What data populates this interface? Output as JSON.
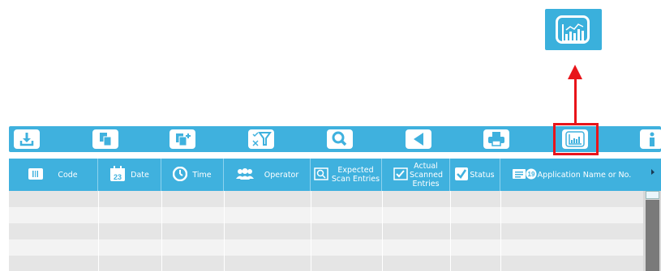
{
  "toolbar": {
    "buttons": [
      {
        "name": "download-icon"
      },
      {
        "name": "copy-icon"
      },
      {
        "name": "add-copy-icon"
      },
      {
        "name": "filter-icon"
      },
      {
        "name": "search-icon"
      },
      {
        "name": "back-icon"
      },
      {
        "name": "print-icon"
      },
      {
        "name": "reports-icon",
        "highlighted": true
      },
      {
        "name": "info-icon"
      }
    ]
  },
  "colors": {
    "accent": "#3fb1de",
    "highlight": "#e8141a",
    "row_odd": "#e5e5e5",
    "row_even": "#f3f3f3"
  },
  "table": {
    "columns": [
      {
        "label": "Code",
        "icon": "barcode-icon"
      },
      {
        "label": "Date",
        "icon": "calendar-icon"
      },
      {
        "label": "Time",
        "icon": "clock-icon"
      },
      {
        "label": "Operator",
        "icon": "users-icon"
      },
      {
        "label": "Expected Scan Entries",
        "icon": "expected-scan-icon"
      },
      {
        "label": "Actual Scanned Entries",
        "icon": "actual-scan-icon"
      },
      {
        "label": "Status",
        "icon": "checkmark-icon"
      },
      {
        "label": "Application Name or No.",
        "icon": "application-id-icon"
      }
    ],
    "calendar_day": "23",
    "app_number_badge": "19",
    "rows": 5
  }
}
